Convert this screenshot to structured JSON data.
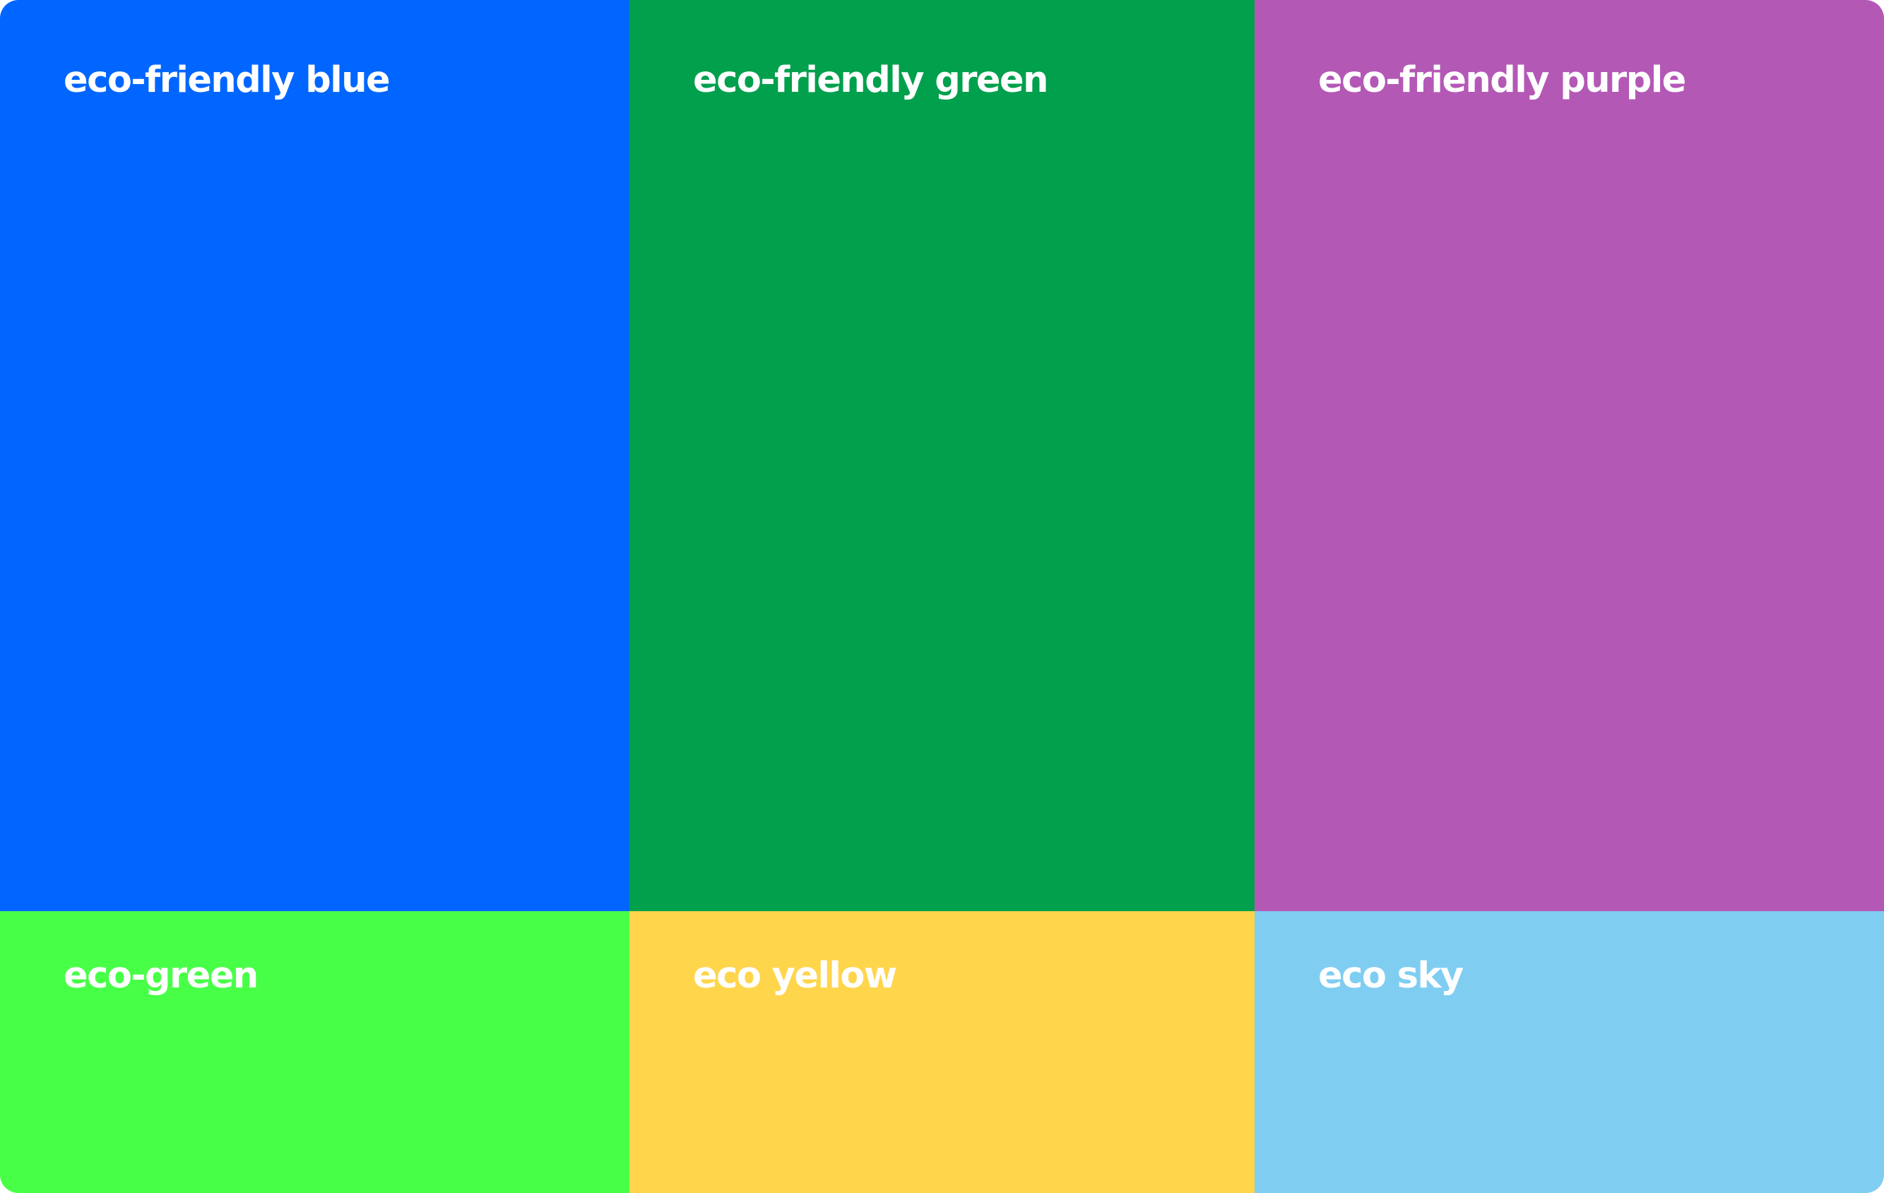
{
  "swatches": [
    {
      "label": "eco-friendly blue",
      "color": "#0066FF"
    },
    {
      "label": "eco-friendly green",
      "color": "#00A04C"
    },
    {
      "label": "eco-friendly purple",
      "color": "#B458B6"
    },
    {
      "label": "eco-green",
      "color": "#48FF48"
    },
    {
      "label": "eco yellow",
      "color": "#FFD54C"
    },
    {
      "label": "eco sky",
      "color": "#80CDF2"
    }
  ]
}
